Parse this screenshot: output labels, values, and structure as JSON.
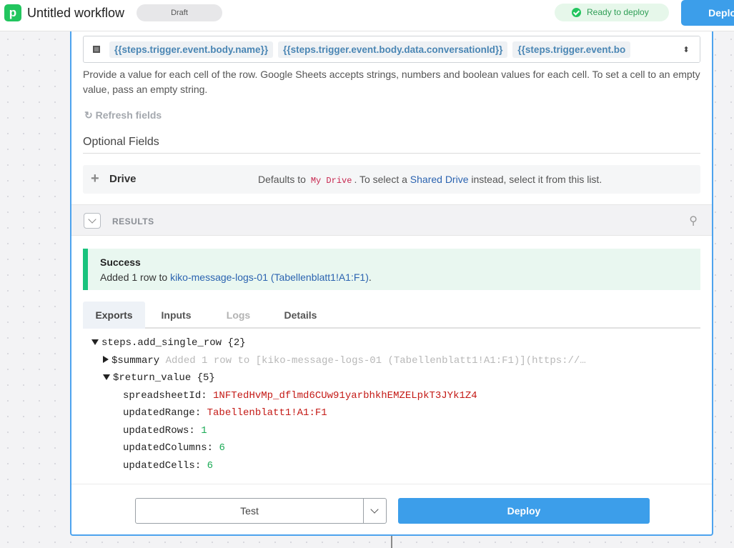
{
  "header": {
    "logo_letter": "p",
    "title": "Untitled workflow",
    "status_pill": "Draft",
    "ready_label": "Ready to deploy",
    "deploy_label": "Deploy"
  },
  "row_field": {
    "tokens": [
      "{{steps.trigger.event.body.name}}",
      "{{steps.trigger.event.body.data.conversationId}}",
      "{{steps.trigger.event.bo"
    ],
    "stepper_glyph": "⬍",
    "help_text": "Provide a value for each cell of the row. Google Sheets accepts strings, numbers and boolean values for each cell. To set a cell to an empty value, pass an empty string."
  },
  "refresh_label": "Refresh fields",
  "optional": {
    "title": "Optional Fields",
    "drive_label": "Drive",
    "drive_help_prefix": "Defaults to",
    "drive_help_code": "My Drive",
    "drive_help_mid": ". To select a",
    "drive_help_link": "Shared Drive",
    "drive_help_suffix": "instead, select it from this list."
  },
  "results": {
    "label": "RESULTS",
    "success_title": "Success",
    "success_prefix": "Added 1 row to",
    "success_link": "kiko-message-logs-01 (Tabellenblatt1!A1:F1)",
    "success_suffix": "."
  },
  "tabs": [
    {
      "label": "Exports",
      "state": "active"
    },
    {
      "label": "Inputs",
      "state": "normal"
    },
    {
      "label": "Logs",
      "state": "disabled"
    },
    {
      "label": "Details",
      "state": "normal"
    }
  ],
  "exports": {
    "root": "steps.add_single_row {2}",
    "summary_key": "$summary",
    "summary_preview": "Added 1 row to [kiko-message-logs-01 (Tabellenblatt1!A1:F1)](https://…",
    "return_key": "$return_value {5}",
    "fields": [
      {
        "key": "spreadsheetId:",
        "value": "1NFTedHvMp_dflmd6CUw91yarbhkhEMZELpkT3JYk1Z4",
        "kind": "str"
      },
      {
        "key": "updatedRange:",
        "value": "Tabellenblatt1!A1:F1",
        "kind": "str"
      },
      {
        "key": "updatedRows:",
        "value": "1",
        "kind": "num"
      },
      {
        "key": "updatedColumns:",
        "value": "6",
        "kind": "num"
      },
      {
        "key": "updatedCells:",
        "value": "6",
        "kind": "num"
      }
    ]
  },
  "footer": {
    "test_label": "Test",
    "deploy_label": "Deploy"
  },
  "colors": {
    "accent": "#3c9eea",
    "success": "#19c37d",
    "brand": "#22c55e"
  }
}
